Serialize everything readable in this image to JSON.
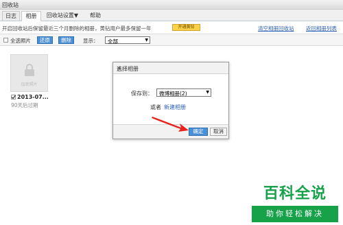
{
  "window": {
    "title": "回收站"
  },
  "tabs": [
    {
      "label": "日志"
    },
    {
      "label": "相册"
    },
    {
      "label": "回收站设置▼"
    },
    {
      "label": "帮助"
    }
  ],
  "infobar": {
    "text": "开启回收站后保留最近三个月删除的相册，黄钻用户最多保留一年",
    "open_vip_button": "开通黄钻",
    "clear_link": "清空相册回收站",
    "back_link": "返回相册列表"
  },
  "toolbar": {
    "select_all_label": "全选照片",
    "restore_button": "还原",
    "delete_button": "删除",
    "display_label": "显示：",
    "display_value": "全部"
  },
  "album": {
    "thumb_label": "加密照片",
    "name": "2013-07...",
    "expire_text": "90天后过期"
  },
  "dialog": {
    "title": "选择相册",
    "close": "×",
    "save_to_label": "保存到：",
    "album_value": "微博相册(2)",
    "or_label": "或者",
    "new_album_link": "新建相册",
    "ok_button": "确定",
    "cancel_button": "取消"
  },
  "annotation": {
    "arrow_color": "#e8231d"
  },
  "watermark": {
    "brand": "百科全说",
    "slogan": "助你轻松解决",
    "color": "#17a24a"
  }
}
